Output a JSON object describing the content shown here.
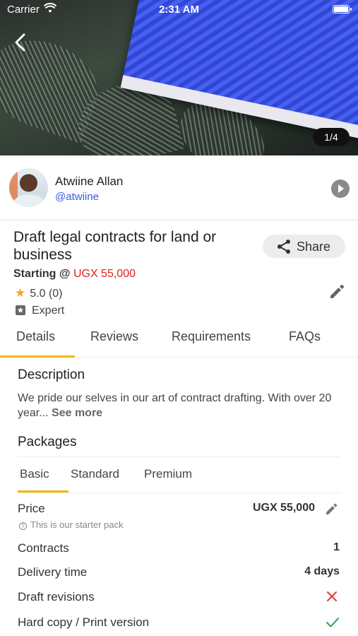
{
  "status_bar": {
    "carrier": "Carrier",
    "time": "2:31 AM"
  },
  "hero": {
    "image_counter": "1/4"
  },
  "seller": {
    "name": "Atwiine Allan",
    "handle": "@atwiine"
  },
  "gig": {
    "title": "Draft legal contracts for land or business",
    "starting_label": "Starting @ ",
    "starting_price": "UGX 55,000",
    "rating": "5.0 (0)",
    "level": "Expert",
    "share_label": "Share"
  },
  "tabs": [
    {
      "label": "Details",
      "active": true
    },
    {
      "label": "Reviews"
    },
    {
      "label": "Requirements"
    },
    {
      "label": "FAQs"
    }
  ],
  "details": {
    "description_title": "Description",
    "description_text": "We pride our selves in our art of contract drafting. With over 20 year...",
    "see_more": "See more",
    "packages_title": "Packages",
    "package_tabs": [
      {
        "label": "Basic",
        "active": true
      },
      {
        "label": "Standard"
      },
      {
        "label": "Premium"
      }
    ],
    "rows": {
      "price": {
        "label": "Price",
        "value": "UGX 55,000",
        "note": "This is our starter pack"
      },
      "contracts": {
        "label": "Contracts",
        "value": "1"
      },
      "delivery": {
        "label": "Delivery time",
        "value": "4 days"
      },
      "revisions": {
        "label": "Draft revisions",
        "included": false
      },
      "hardcopy": {
        "label": "Hard copy / Print version",
        "included": true
      }
    }
  },
  "colors": {
    "accent": "#f5b800",
    "price_red": "#e02020",
    "handle_blue": "#3b5bdb",
    "check_green": "#2e9e4f",
    "x_red": "#e53935"
  }
}
